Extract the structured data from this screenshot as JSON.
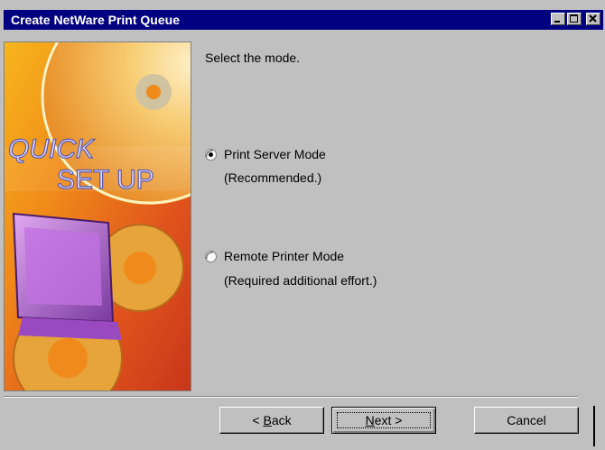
{
  "window": {
    "title": "Create NetWare Print Queue"
  },
  "illustration": {
    "line1": "QUICK",
    "line2": "SET UP"
  },
  "prompt": "Select the mode.",
  "options": [
    {
      "label": "Print Server Mode",
      "note": "(Recommended.)",
      "selected": true
    },
    {
      "label": "Remote Printer Mode",
      "note": "(Required additional effort.)",
      "selected": false
    }
  ],
  "buttons": {
    "back_prefix": "< ",
    "back_key": "B",
    "back_rest": "ack",
    "next_key": "N",
    "next_rest": "ext >",
    "cancel": "Cancel"
  },
  "colors": {
    "titlebar": "#000080",
    "face": "#c0c0c0"
  }
}
